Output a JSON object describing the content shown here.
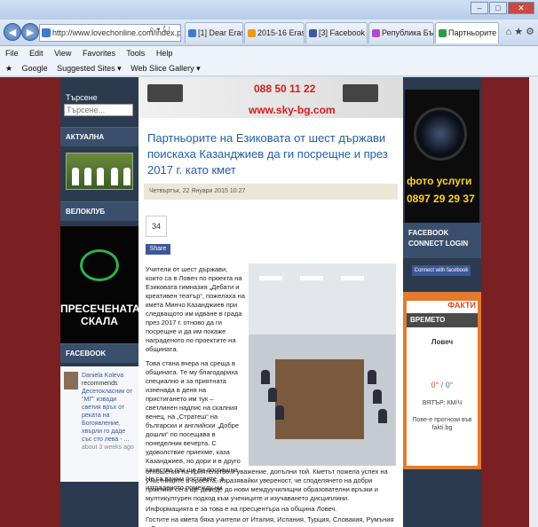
{
  "browser": {
    "address": "http://www.lovechonline.com/index.php/politika/37102-p",
    "tabs": [
      {
        "label": "[1] Dear Erasmus+ Coor...",
        "color": "#3b7bd4"
      },
      {
        "label": "2015-16 Erasmus+ KA2 ...",
        "color": "#e79b1e"
      },
      {
        "label": "[3] Facebook",
        "color": "#3b5998"
      },
      {
        "label": "Република България - ...",
        "color": "#b04ac7"
      },
      {
        "label": "Партньорите на Ези...",
        "color": "#2d9a4a"
      }
    ],
    "menu": [
      "File",
      "Edit",
      "View",
      "Favorites",
      "Tools",
      "Help"
    ],
    "favorites": [
      "Google",
      "Suggested Sites ▾",
      "Web Slice Gallery ▾"
    ],
    "controls": {
      "minimize": "–",
      "maximize": "□",
      "close": "✕"
    }
  },
  "left": {
    "search_label": "Търсене",
    "search_placeholder": "Търсене...",
    "gallery_title": "АКТУАЛНА ГАЛЕРИЯ",
    "veloklub_title": "ВЕЛОКЛУБ",
    "velo_text": "ПРЕСЕЧЕНАТА СКАЛА",
    "facebook_title": "FACEBOOK",
    "fb_post": {
      "name": "Daniela Koleva",
      "action": "recommends",
      "text": "Десетокласник от \"МГ\" извади светия връх от реката на Богоявление, хвърли го даде със сто лева - ...",
      "time": "about 3 weeks ago"
    }
  },
  "main": {
    "banner_phone": "088 50 11 22",
    "banner_site": "www.sky-bg.com",
    "title": "Партньорите на Езиковата от шест държави поискаха Казанджиев да ги посрещне и през 2017 г. като кмет",
    "date": "Четвъртък, 22 Януари 2015 10:27",
    "share_count": "34",
    "share_label": "Share",
    "p1": "Учители от шест държави, които са в Ловеч по проекта на Езиковата гимназия „Дебати и креативен театър“, пожелаха на кмета Минчо Казанджиев при следващото им идване в града през 2017 г. отново да ги посрещне и да им покаже награденото по проектите на общината.",
    "p2": "Това стана вчера на среща в общината. Те му благодариха специално и за приятната изненада в деня на пристигането им тук – светлинен надпис на скалния венец, на „Стратеш“ на български и английски „Добре дошли“ по посещава в понеделник вечерта. С удоволствие приехме, каза Казанджиев, но дори и в друго качество пак ще ви посрещна. Не са важни постовете, а изграденото помежду ни",
    "p3": "отношения на приятелство и уважение, допълни той. Кметът пожела успех на участниците в проекта, изразявайки увереност, че споделянето на добри практики сега ще доведе до нови междуучилищни образователни връзки и мултикултурен подход към учениците и изучаването дисциплини.",
    "p4": "Информацията е за това е на пресцентъра на община Ловеч.",
    "p5": "Гостите на кмета бяха учители от Италия, Испания, Турция, Словакия, Румъния и Гърция, чиито училища са с"
  },
  "right": {
    "photo_ad_1": "фото услуги",
    "photo_ad_2": "0897 29 29 37",
    "fb_connect": "FACEBOOK CONNECT LOGIN",
    "fb_connect_btn": "Connect with facebook",
    "weather_title": "ВРЕМЕТО",
    "weather_brand": "ФАКТИ",
    "city": "Ловеч",
    "temp_hi": "0",
    "temp_lo": "0",
    "wind": "ВЯТЪР: КМ/Ч",
    "more": "Пове-е прогнози във fakti.bg"
  }
}
